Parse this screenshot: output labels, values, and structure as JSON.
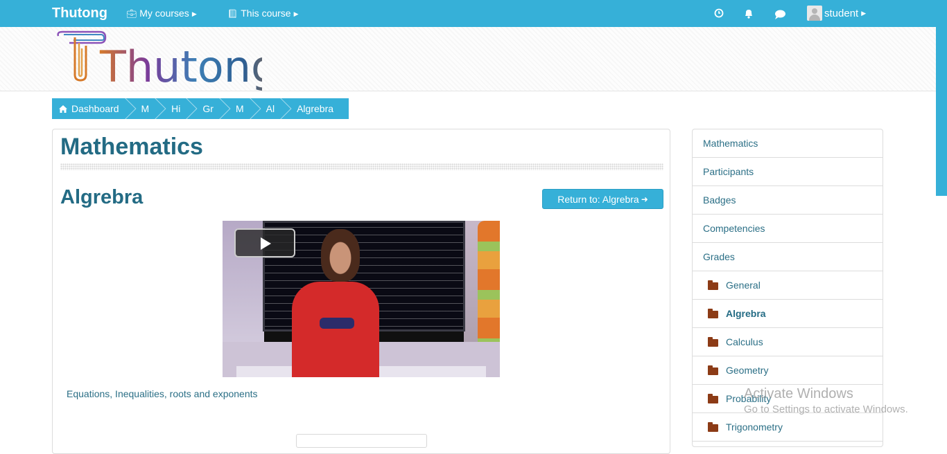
{
  "navbar": {
    "brand": "Thutong",
    "my_courses": "My courses",
    "this_course": "This course",
    "user_name": "student"
  },
  "logo_text": "Thutong.",
  "breadcrumb": [
    "Dashboard",
    "M",
    "Hi",
    "Gr",
    "M",
    "Al",
    "Algrebra"
  ],
  "main": {
    "course_title": "Mathematics",
    "section_title": "Algrebra",
    "return_button": "Return to: Algrebra",
    "summary": "Equations, Inequalities, roots and exponents"
  },
  "sidebar": {
    "items": [
      {
        "label": "Mathematics"
      },
      {
        "label": "Participants"
      },
      {
        "label": "Badges"
      },
      {
        "label": "Competencies"
      },
      {
        "label": "Grades"
      },
      {
        "label": "General"
      },
      {
        "label": "Algrebra"
      },
      {
        "label": "Calculus"
      },
      {
        "label": "Geometry"
      },
      {
        "label": "Probability"
      },
      {
        "label": "Trigonometry"
      }
    ]
  },
  "watermark": {
    "line1": "Activate Windows",
    "line2": "Go to Settings to activate Windows."
  },
  "colors": {
    "navbar": "#36b0d8",
    "heading": "#236b84",
    "folder": "#8c3b16"
  }
}
